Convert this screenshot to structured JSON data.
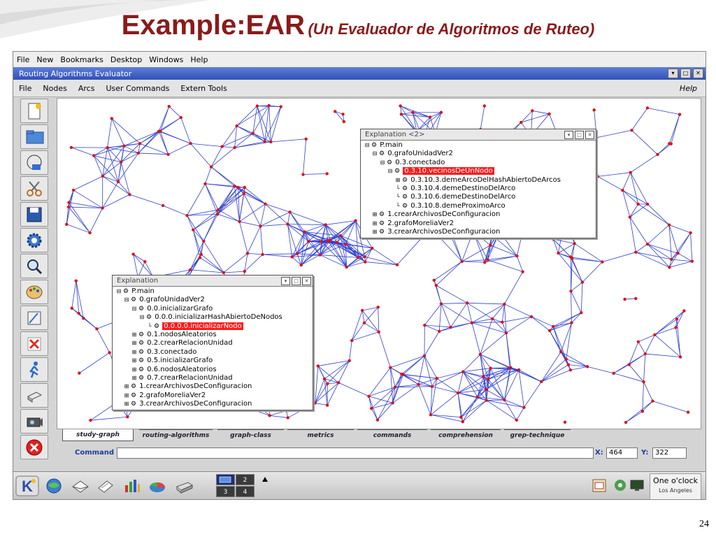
{
  "slide": {
    "title_main": "Example:EAR",
    "title_sub": "(Un Evaluador de Algoritmos de Ruteo)",
    "page_number": "24"
  },
  "desktop_menu": [
    "File",
    "New",
    "Bookmarks",
    "Desktop",
    "Windows",
    "Help"
  ],
  "window": {
    "title": "Routing Algorithms Evaluator"
  },
  "app_menu": {
    "items": [
      "File",
      "Nodes",
      "Arcs",
      "User Commands",
      "Extern Tools"
    ],
    "help": "Help"
  },
  "toolbar_icons": [
    "new-file-icon",
    "folder-icon",
    "globe-disk-icon",
    "scissors-icon",
    "save-icon",
    "settings-gear-icon",
    "magnifier-icon",
    "palette-icon",
    "draw-icon",
    "delete-icon",
    "run-icon",
    "print-icon",
    "camera-icon",
    "close-red-icon"
  ],
  "explanation_windows": [
    {
      "title": "Explanation <2>",
      "rows": [
        {
          "indent": 0,
          "expander": "−",
          "label": "P.main",
          "selected": false
        },
        {
          "indent": 1,
          "expander": "−",
          "label": "0.grafoUnidadVer2",
          "selected": false
        },
        {
          "indent": 2,
          "expander": "−",
          "label": "0.3.conectado",
          "selected": false
        },
        {
          "indent": 3,
          "expander": "−",
          "label": "0.3.10.vecinosDeUnNodo",
          "selected": true
        },
        {
          "indent": 4,
          "expander": "+",
          "label": "0.3.10.3.demeArcoDelHashAbiertoDeArcos",
          "selected": false
        },
        {
          "indent": 4,
          "expander": "",
          "label": "0.3.10.4.demeDestinoDelArco",
          "selected": false
        },
        {
          "indent": 4,
          "expander": "",
          "label": "0.3.10.6.demeDestinoDelArco",
          "selected": false
        },
        {
          "indent": 4,
          "expander": "",
          "label": "0.3.10.8.demeProximoArco",
          "selected": false
        },
        {
          "indent": 1,
          "expander": "+",
          "label": "1.crearArchivosDeConfiguracion",
          "selected": false
        },
        {
          "indent": 1,
          "expander": "+",
          "label": "2.grafoMoreliaVer2",
          "selected": false
        },
        {
          "indent": 1,
          "expander": "+",
          "label": "3.crearArchivosDeConfiguracion",
          "selected": false
        }
      ]
    },
    {
      "title": "Explanation",
      "rows": [
        {
          "indent": 0,
          "expander": "−",
          "label": "P.main",
          "selected": false
        },
        {
          "indent": 1,
          "expander": "−",
          "label": "0.grafoUnidadVer2",
          "selected": false
        },
        {
          "indent": 2,
          "expander": "−",
          "label": "0.0.inicializarGrafo",
          "selected": false
        },
        {
          "indent": 3,
          "expander": "−",
          "label": "0.0.0.inicializarHashAbiertoDeNodos",
          "selected": false
        },
        {
          "indent": 4,
          "expander": "",
          "label": "0.0.0.0.inicializarNodo",
          "selected": true
        },
        {
          "indent": 2,
          "expander": "+",
          "label": "0.1.nodosAleatorios",
          "selected": false
        },
        {
          "indent": 2,
          "expander": "+",
          "label": "0.2.crearRelacionUnidad",
          "selected": false
        },
        {
          "indent": 2,
          "expander": "+",
          "label": "0.3.conectado",
          "selected": false
        },
        {
          "indent": 2,
          "expander": "+",
          "label": "0.5.inicializarGrafo",
          "selected": false
        },
        {
          "indent": 2,
          "expander": "+",
          "label": "0.6.nodosAleatorios",
          "selected": false
        },
        {
          "indent": 2,
          "expander": "+",
          "label": "0.7.crearRelacionUnidad",
          "selected": false
        },
        {
          "indent": 1,
          "expander": "+",
          "label": "1.crearArchivosDeConfiguracion",
          "selected": false
        },
        {
          "indent": 1,
          "expander": "+",
          "label": "2.grafoMoreliaVer2",
          "selected": false
        },
        {
          "indent": 1,
          "expander": "+",
          "label": "3.crearArchivosDeConfiguracion",
          "selected": false
        }
      ]
    }
  ],
  "tabs": [
    "study-graph",
    "routing-algorithms",
    "graph-class",
    "metrics",
    "commands",
    "comprehension",
    "grep-technique"
  ],
  "active_tab": 0,
  "command": {
    "label": "Command",
    "value": "",
    "x_label": "X:",
    "x_value": "464",
    "y_label": "Y:",
    "y_value": "322"
  },
  "taskbar": {
    "pager": [
      "",
      "2",
      "3",
      "4"
    ],
    "clock_time": "One o'clock",
    "clock_place": "Los Angeles",
    "icons": [
      "k-menu-icon",
      "browser-icon",
      "mail-icon",
      "editor-icon",
      "chart-app-icon",
      "pie-app-icon",
      "printer-icon",
      "tray-calendar-icon",
      "tray-network-icon",
      "tray-monitor-icon"
    ]
  },
  "colors": {
    "title_red": "#8b1a1a",
    "edge_blue": "#2d3fd0",
    "node_red": "#e01010",
    "selection_red": "#ff1a1a",
    "titlebar_blue": "#3a5ac0"
  }
}
